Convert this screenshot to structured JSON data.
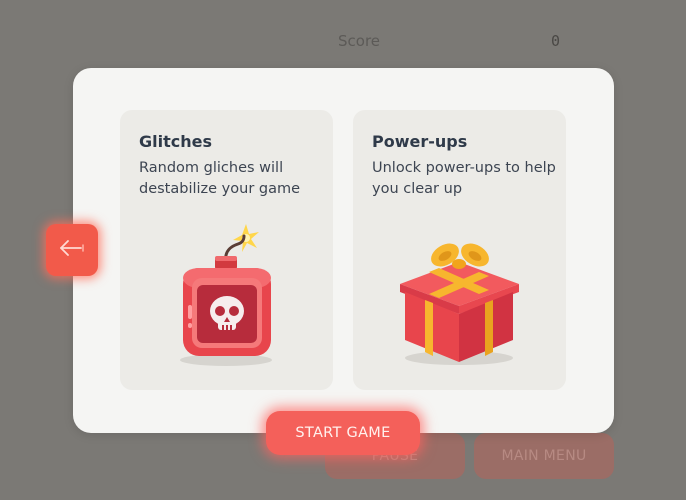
{
  "hud": {
    "score_label": "Score",
    "score_value": "0"
  },
  "background_buttons": {
    "pause_label": "PAUSE",
    "main_menu_label": "MAIN MENU"
  },
  "modal": {
    "cards": [
      {
        "title": "Glitches",
        "description": "Random gliches will destabilize your game",
        "icon": "bomb-skull-icon"
      },
      {
        "title": "Power-ups",
        "description": "Unlock power-ups to help you clear up",
        "icon": "gift-box-icon"
      }
    ],
    "back_icon": "arrow-left-icon",
    "start_label": "START GAME"
  },
  "colors": {
    "overlay": "#7b7975",
    "modal_bg": "#f5f5f3",
    "card_bg": "#ecebe7",
    "accent": "#f4605a",
    "title_text": "#2f3a49"
  }
}
